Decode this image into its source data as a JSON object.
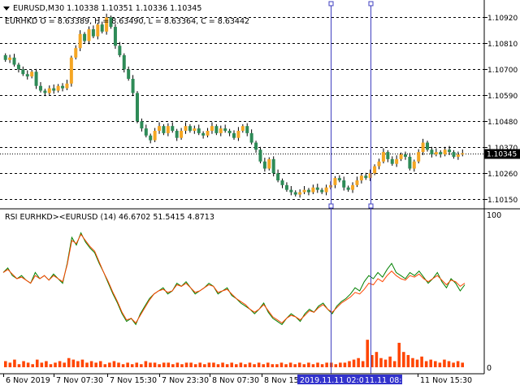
{
  "chart_data": [
    {
      "type": "candlestick",
      "header": {
        "symbol_line": "EURUSD,M30  1.10338 1.10351 1.10336 1.10345",
        "overlay_line": "EURHKD O = 8.63389, H = 8.63490, L = 8.63364, C = 8.63442"
      },
      "y_ticks": [
        "1.10920",
        "1.10810",
        "1.10700",
        "1.10590",
        "1.10480",
        "1.10370",
        "1.10260",
        "1.10150"
      ],
      "y_tick_values": [
        1.1092,
        1.1081,
        1.107,
        1.1059,
        1.1048,
        1.1037,
        1.1026,
        1.1015
      ],
      "ylim": [
        1.1012,
        1.1098
      ],
      "current_price_label": "1.10345",
      "current_price": 1.10345,
      "close_series": [
        1.1074,
        1.1075,
        1.1072,
        1.107,
        1.1068,
        1.1067,
        1.1069,
        1.1063,
        1.1061,
        1.106,
        1.1062,
        1.1061,
        1.1063,
        1.1062,
        1.1064,
        1.1075,
        1.1079,
        1.1085,
        1.1082,
        1.1087,
        1.1084,
        1.1089,
        1.1086,
        1.1092,
        1.1088,
        1.108,
        1.1076,
        1.107,
        1.1066,
        1.106,
        1.1048,
        1.1045,
        1.1042,
        1.104,
        1.1044,
        1.1046,
        1.1043,
        1.1046,
        1.1044,
        1.1041,
        1.1044,
        1.1046,
        1.1044,
        1.1045,
        1.1043,
        1.1042,
        1.1044,
        1.1046,
        1.1043,
        1.1045,
        1.1044,
        1.1043,
        1.1041,
        1.1044,
        1.1046,
        1.1043,
        1.1039,
        1.1036,
        1.1031,
        1.1028,
        1.1032,
        1.1026,
        1.1023,
        1.1021,
        1.1019,
        1.1018,
        1.1017,
        1.1018,
        1.1019,
        1.1018,
        1.102,
        1.1019,
        1.1018,
        1.102,
        1.1021,
        1.1024,
        1.1023,
        1.102,
        1.1019,
        1.1021,
        1.1023,
        1.1025,
        1.1024,
        1.1026,
        1.1029,
        1.1031,
        1.1035,
        1.1032,
        1.103,
        1.1032,
        1.1034,
        1.1033,
        1.1028,
        1.1031,
        1.1035,
        1.1039,
        1.1036,
        1.1034,
        1.1035,
        1.1034,
        1.1036,
        1.1035,
        1.1033,
        1.1034,
        1.10345
      ]
    },
    {
      "type": "line",
      "title": "RSI EURHKD><EURUSD (14) 46.6702 51.5415 4.8713",
      "y_ticks": [
        "100",
        "0"
      ],
      "ylim": [
        0,
        100
      ],
      "series": [
        {
          "color": "#008000",
          "values": [
            62,
            65,
            60,
            58,
            60,
            57,
            55,
            62,
            58,
            60,
            57,
            61,
            58,
            55,
            68,
            85,
            80,
            88,
            82,
            78,
            75,
            68,
            62,
            55,
            48,
            42,
            35,
            30,
            32,
            28,
            35,
            40,
            45,
            48,
            50,
            52,
            48,
            50,
            55,
            53,
            56,
            52,
            48,
            50,
            52,
            55,
            53,
            48,
            50,
            52,
            47,
            45,
            42,
            40,
            38,
            35,
            38,
            42,
            36,
            32,
            30,
            28,
            32,
            35,
            33,
            30,
            35,
            38,
            36,
            40,
            42,
            38,
            35,
            40,
            43,
            45,
            48,
            52,
            50,
            56,
            60,
            58,
            62,
            59,
            64,
            68,
            62,
            60,
            58,
            62,
            60,
            63,
            59,
            55,
            58,
            62,
            56,
            52,
            58,
            55,
            50,
            54
          ]
        },
        {
          "color": "#ff4500",
          "values": [
            62,
            64,
            61,
            58,
            59,
            57,
            55,
            60,
            58,
            60,
            57,
            60,
            58,
            56,
            67,
            83,
            81,
            87,
            83,
            79,
            76,
            69,
            62,
            56,
            49,
            43,
            36,
            31,
            32,
            29,
            34,
            39,
            44,
            48,
            50,
            51,
            49,
            50,
            54,
            53,
            55,
            52,
            49,
            50,
            52,
            54,
            53,
            49,
            50,
            51,
            48,
            45,
            43,
            41,
            38,
            36,
            38,
            41,
            37,
            33,
            31,
            29,
            32,
            34,
            33,
            31,
            34,
            37,
            36,
            39,
            41,
            38,
            36,
            39,
            42,
            44,
            46,
            49,
            48,
            51,
            55,
            54,
            58,
            56,
            60,
            63,
            60,
            58,
            57,
            60,
            59,
            61,
            58,
            56,
            58,
            60,
            57,
            54,
            57,
            56,
            53,
            55
          ]
        }
      ],
      "histogram": {
        "color": "#ff4500",
        "values": [
          4,
          3,
          5,
          2,
          4,
          3,
          2,
          5,
          3,
          4,
          2,
          3,
          4,
          3,
          6,
          5,
          4,
          5,
          3,
          4,
          3,
          4,
          2,
          3,
          4,
          3,
          2,
          3,
          2,
          3,
          2,
          4,
          3,
          3,
          2,
          3,
          3,
          2,
          3,
          2,
          3,
          3,
          2,
          3,
          2,
          3,
          3,
          2,
          3,
          2,
          3,
          2,
          3,
          2,
          3,
          2,
          3,
          2,
          3,
          2,
          2,
          3,
          2,
          3,
          2,
          3,
          2,
          3,
          2,
          3,
          2,
          3,
          3,
          2,
          3,
          3,
          4,
          5,
          6,
          4,
          18,
          8,
          10,
          6,
          5,
          7,
          4,
          16,
          10,
          8,
          6,
          5,
          7,
          4,
          5,
          4,
          3,
          5,
          4,
          3,
          4,
          3
        ]
      }
    }
  ],
  "x_ticks": [
    "6 Nov 2019",
    "7 Nov 07:30",
    "7 Nov 15:30",
    "7 Nov 23:30",
    "8 Nov 07:30",
    "8 Nov 15:30",
    "11 Nov 15:30"
  ],
  "crosshair_labels": [
    "2019.11.11 02:00",
    "11.11 08:00"
  ],
  "colors": {
    "bull": "#f5a623",
    "bear": "#2e8b57",
    "grid": "#000000",
    "crosshair": "#4040c0",
    "label_bg": "#3333cc"
  }
}
